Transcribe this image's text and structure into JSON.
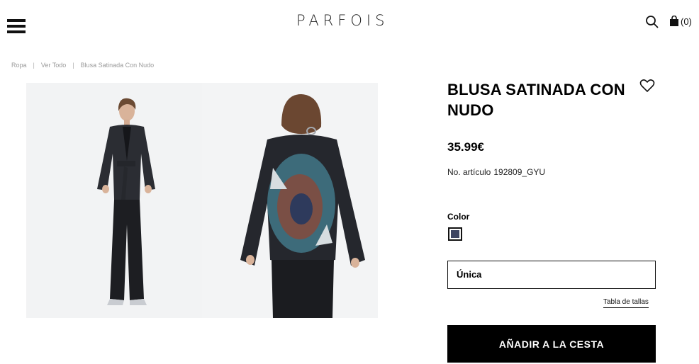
{
  "header": {
    "logo": "PARFOIS",
    "cart_count": "(0)"
  },
  "breadcrumb": {
    "items": [
      "Ropa",
      "Ver Todo",
      "Blusa Satinada Con Nudo"
    ],
    "separator": "|"
  },
  "product": {
    "title": "BLUSA SATINADA CON NUDO",
    "price": "35.99€",
    "reference_label": "No. artículo",
    "reference_value": "192809_GYU",
    "color_label": "Color",
    "color_swatch": "#3e4562",
    "size_value": "Única",
    "size_guide": "Tabla de tallas",
    "add_to_cart": "AÑADIR A LA CESTA"
  },
  "colors": {
    "text": "#111111",
    "button_bg": "#000000",
    "button_text": "#ffffff",
    "breadcrumb": "#9a9a9a",
    "photo_bg": "#f1f2f3"
  },
  "icons": [
    "menu-icon",
    "search-icon",
    "bag-icon",
    "heart-icon"
  ]
}
